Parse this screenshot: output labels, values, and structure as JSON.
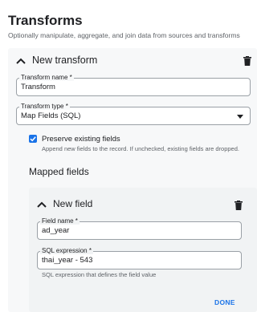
{
  "page": {
    "title": "Transforms",
    "subtitle": "Optionally manipulate, aggregate, and join data from sources and transforms"
  },
  "transform": {
    "header_title": "New transform",
    "name_label": "Transform name *",
    "name_value": "Transform",
    "type_label": "Transform type *",
    "type_value": "Map Fields (SQL)",
    "preserve_label": "Preserve existing fields",
    "preserve_help": "Append new fields to the record. If unchecked, existing fields are dropped.",
    "preserve_checked": true
  },
  "mapped_fields": {
    "section_title": "Mapped fields",
    "field": {
      "header_title": "New field",
      "name_label": "Field name *",
      "name_value": "ad_year",
      "sql_label": "SQL expression *",
      "sql_value": "thai_year - 543",
      "sql_help": "SQL expression that defines the field value",
      "done_label": "DONE"
    }
  },
  "icons": {
    "collapse": "chevron-up-icon",
    "delete": "trash-icon",
    "dropdown": "dropdown-arrow-icon",
    "checkbox": "checkbox-checked-icon"
  },
  "colors": {
    "accent": "#1a73e8",
    "card_bg": "#f7f8f9",
    "inner_card_bg": "#f1f3f4"
  }
}
